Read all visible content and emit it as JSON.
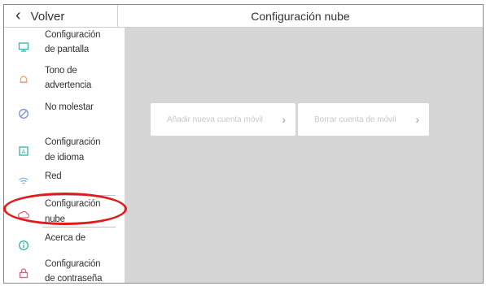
{
  "header": {
    "back_label": "Volver",
    "title": "Configuración nube"
  },
  "sidebar": {
    "items": [
      {
        "line1": "Configuración",
        "line2": "de pantalla",
        "icon": "monitor-icon"
      },
      {
        "line1": "Tono de",
        "line2": "advertencia",
        "icon": "bell-icon"
      },
      {
        "line1": "No molestar",
        "line2": "",
        "icon": "do-not-disturb-icon"
      },
      {
        "line1": "Configuración",
        "line2": "de idioma",
        "icon": "language-icon"
      },
      {
        "line1": "Red",
        "line2": "",
        "icon": "wifi-icon"
      },
      {
        "line1": "Configuración",
        "line2": "nube",
        "icon": "cloud-icon"
      },
      {
        "line1": "Acerca de",
        "line2": "",
        "icon": "info-icon"
      },
      {
        "line1": "Configuración",
        "line2": "de contraseña",
        "icon": "lock-icon"
      }
    ]
  },
  "main": {
    "add_account": "Añadir nueva cuenta móvil",
    "delete_account": "Borrar cuenta de móvil"
  },
  "colors": {
    "icon_accent": "#2bb8a8",
    "highlight": "#e31a1a",
    "content_bg": "#d6d6d6"
  }
}
